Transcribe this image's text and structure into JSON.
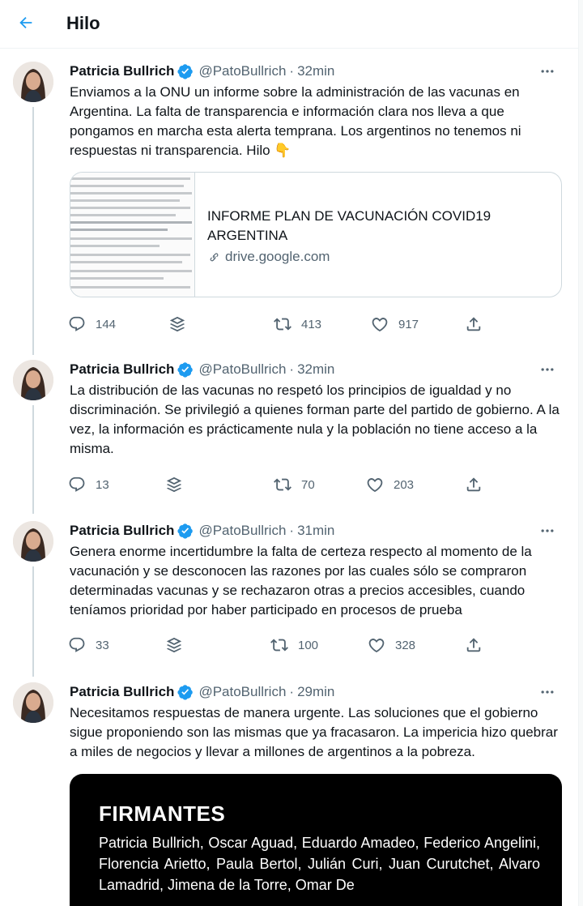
{
  "header": {
    "title": "Hilo"
  },
  "tweets": [
    {
      "name": "Patricia Bullrich",
      "handle": "@PatoBullrich",
      "separator": "·",
      "time": "32min",
      "text": "Enviamos a la ONU un informe sobre la administración de las vacunas en Argentina. La falta de transparencia e información clara nos lleva a que pongamos en marcha esta alerta temprana. Los argentinos no tenemos ni respuestas ni transparencia. Hilo 👇",
      "card": {
        "title": "INFORME PLAN DE VACUNACIÓN COVID19 ARGENTINA",
        "domain": "drive.google.com"
      },
      "replies": "144",
      "retweets": "413",
      "likes": "917"
    },
    {
      "name": "Patricia Bullrich",
      "handle": "@PatoBullrich",
      "separator": "·",
      "time": "32min",
      "text": "La distribución de las vacunas no respetó los principios de igualdad y no discriminación. Se privilegió a quienes forman parte del partido de gobierno. A la vez, la información es prácticamente nula y la población no tiene acceso a la misma.",
      "replies": "13",
      "retweets": "70",
      "likes": "203"
    },
    {
      "name": "Patricia Bullrich",
      "handle": "@PatoBullrich",
      "separator": "·",
      "time": "31min",
      "text": "Genera enorme incertidumbre la falta de certeza respecto al momento de la vacunación y se desconocen las razones por las cuales sólo se compraron determinadas vacunas y se rechazaron otras a precios accesibles, cuando teníamos prioridad por haber participado en procesos de prueba",
      "replies": "33",
      "retweets": "100",
      "likes": "328"
    },
    {
      "name": "Patricia Bullrich",
      "handle": "@PatoBullrich",
      "separator": "·",
      "time": "29min",
      "text": "Necesitamos respuestas de manera urgente. Las soluciones que el gobierno sigue proponiendo son las mismas que ya fracasaron. La impericia hizo quebrar a miles de negocios y llevar a millones de argentinos a la pobreza.",
      "media": {
        "title": "FIRMANTES",
        "text": "Patricia Bullrich, Oscar Aguad, Eduardo Amadeo, Federico Angelini, Florencia Arietto, Paula Bertol, Julián Curi, Juan Curutchet, Alvaro Lamadrid, Jimena de la Torre, Omar De"
      }
    }
  ],
  "colors": {
    "accent": "#1d9bf0",
    "text": "#0f1419",
    "secondary": "#536471",
    "border": "#cfd9de"
  },
  "icons": [
    "back-arrow-icon",
    "verified-badge-icon",
    "more-icon",
    "link-icon",
    "reply-icon",
    "stack-icon",
    "retweet-icon",
    "like-icon",
    "share-icon"
  ]
}
